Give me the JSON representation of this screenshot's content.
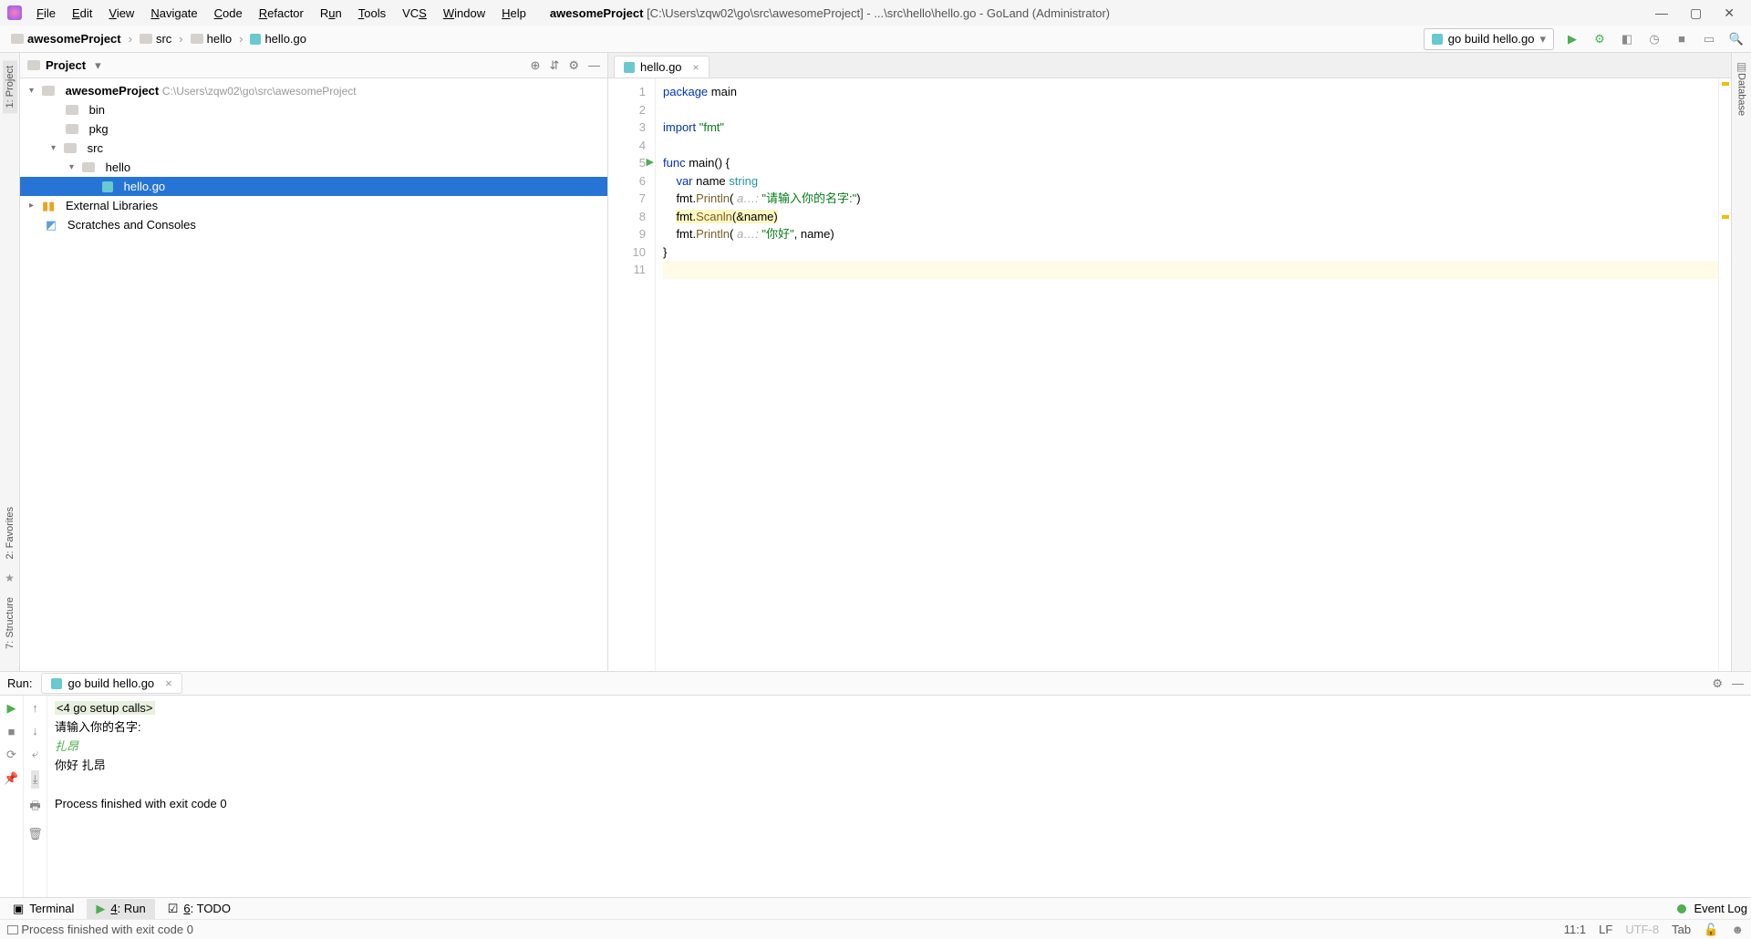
{
  "menu": [
    "File",
    "Edit",
    "View",
    "Navigate",
    "Code",
    "Refactor",
    "Run",
    "Tools",
    "VCS",
    "Window",
    "Help"
  ],
  "title_project": "awesomeProject",
  "title_suffix": "[C:\\Users\\zqw02\\go\\src\\awesomeProject] - ...\\src\\hello\\hello.go - GoLand (Administrator)",
  "breadcrumbs": {
    "project": "awesomeProject",
    "folders": [
      "src",
      "hello"
    ],
    "file": "hello.go"
  },
  "run_config": "go build hello.go",
  "project": {
    "label": "Project",
    "root_name": "awesomeProject",
    "root_path": "C:\\Users\\zqw02\\go\\src\\awesomeProject",
    "bin": "bin",
    "pkg": "pkg",
    "src": "src",
    "hello": "hello",
    "hello_go": "hello.go",
    "ext_lib": "External Libraries",
    "scratches": "Scratches and Consoles"
  },
  "tab_file": "hello.go",
  "code": {
    "l1a": "package",
    "l1b": " main",
    "l3a": "import",
    "l3b": " \"fmt\"",
    "l5a": "func",
    "l5b": " main",
    "l5c": "() {",
    "l6a": "    var",
    "l6b": " name ",
    "l6c": "string",
    "l7a": "    fmt.",
    "l7b": "Println",
    "l7c": "( ",
    "l7h": "a…:",
    "l7d": " \"请输入你的名字:\"",
    "l7e": ")",
    "l8a": "    ",
    "l8b": "fmt.",
    "l8c": "Scanln",
    "l8d": "(&name)",
    "l9a": "    fmt.",
    "l9b": "Println",
    "l9c": "( ",
    "l9h": "a…:",
    "l9d": " \"你好\"",
    "l9e": ", name)",
    "l10": "}"
  },
  "gutter_lines": [
    "1",
    "2",
    "3",
    "4",
    "5",
    "6",
    "7",
    "8",
    "9",
    "10",
    "11"
  ],
  "run": {
    "label": "Run:",
    "tab": "go build hello.go",
    "fold": "<4 go setup calls>",
    "line2": "请输入你的名字:",
    "line3": "扎昂",
    "line4": "你好 扎昂",
    "line5": "",
    "line6": "Process finished with exit code 0"
  },
  "bottom_tools": {
    "terminal": "Terminal",
    "run": "4: Run",
    "todo": "6: TODO",
    "event_log": "Event Log"
  },
  "left_tabs": {
    "project": "1: Project",
    "structure": "7: Structure",
    "favorites": "2: Favorites"
  },
  "right_tab": "Database",
  "status": {
    "msg": "Process finished with exit code 0",
    "pos": "11:1",
    "le": "LF",
    "enc": "UTF-8",
    "indent": "Tab"
  }
}
